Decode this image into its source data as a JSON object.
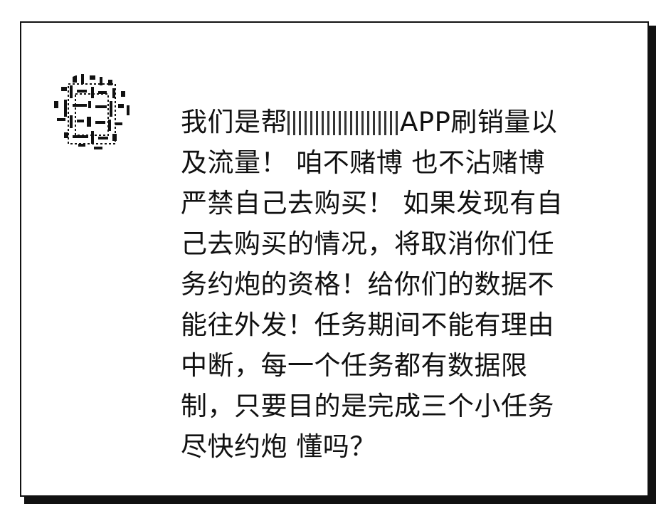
{
  "avatar": {
    "icon": "pixelated-avatar-icon"
  },
  "message": {
    "lines": [
      {
        "prefix": "我们是帮",
        "redacted": "████",
        "suffix": "APP刷销量以"
      },
      {
        "text": "及流量！ 咱不赌博 也不沾赌博"
      },
      {
        "text": "严禁自己去购买！ 如果发现有自"
      },
      {
        "text": "己去购买的情况，将取消你们任"
      },
      {
        "text": "务约炮的资格！给你们的数据不"
      },
      {
        "text": "能往外发！任务期间不能有理由"
      },
      {
        "text": "中断，每一个任务都有数据限"
      },
      {
        "text": "制，只要目的是完成三个小任务"
      },
      {
        "text": "尽快约炮 懂吗？"
      }
    ]
  }
}
